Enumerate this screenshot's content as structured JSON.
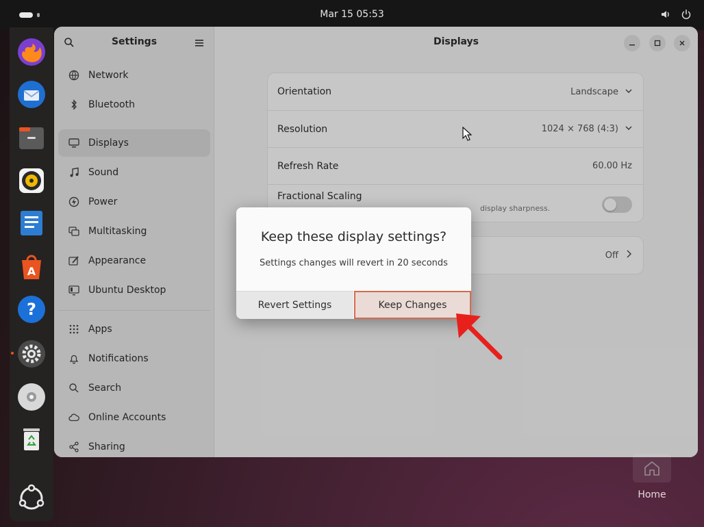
{
  "topbar": {
    "clock": "Mar 15  05:53"
  },
  "dock": {
    "items": [
      "firefox-icon",
      "thunderbird-icon",
      "files-icon",
      "rhythmbox-icon",
      "writer-icon",
      "app-center-icon",
      "help-icon",
      "settings-icon",
      "disc-icon",
      "trash-icon",
      "show-apps-icon"
    ]
  },
  "sidebar": {
    "title": "Settings",
    "items": [
      {
        "label": "Network"
      },
      {
        "label": "Bluetooth"
      },
      {
        "label": "Displays"
      },
      {
        "label": "Sound"
      },
      {
        "label": "Power"
      },
      {
        "label": "Multitasking"
      },
      {
        "label": "Appearance"
      },
      {
        "label": "Ubuntu Desktop"
      },
      {
        "label": "Apps"
      },
      {
        "label": "Notifications"
      },
      {
        "label": "Search"
      },
      {
        "label": "Online Accounts"
      },
      {
        "label": "Sharing"
      }
    ]
  },
  "content": {
    "title": "Displays",
    "orientation": {
      "label": "Orientation",
      "value": "Landscape"
    },
    "resolution": {
      "label": "Resolution",
      "value": "1024 × 768 (4:3)"
    },
    "refresh_rate": {
      "label": "Refresh Rate",
      "value": "60.00 Hz"
    },
    "fractional_scaling": {
      "label": "Fractional Scaling",
      "sub_visible": "display sharpness."
    },
    "night_light": {
      "value": "Off"
    }
  },
  "dialog": {
    "title": "Keep these display settings?",
    "body": "Settings changes will revert in 20 seconds",
    "revert_label": "Revert Settings",
    "keep_label": "Keep Changes"
  },
  "desktop": {
    "home_label": "Home"
  },
  "colors": {
    "accent": "#e95420",
    "highlight_border": "#d56a50",
    "annotation_arrow": "#e8201c"
  }
}
